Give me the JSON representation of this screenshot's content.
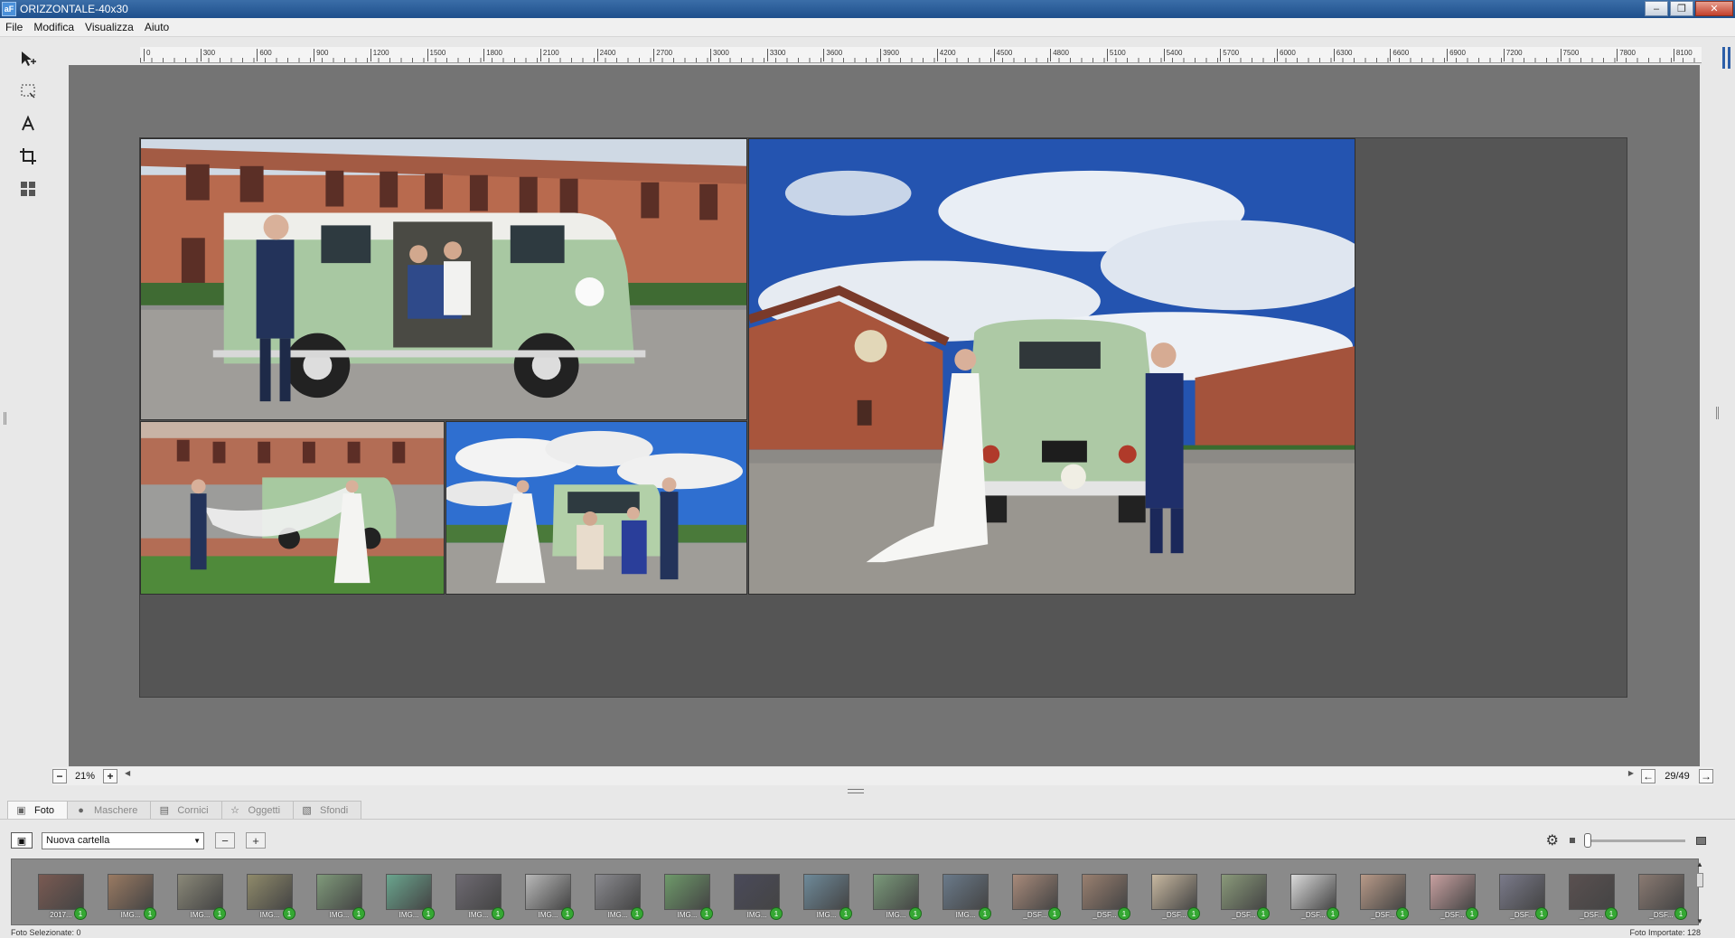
{
  "window": {
    "title": "ORIZZONTALE-40x30",
    "app_icon": "aF"
  },
  "menu": [
    "File",
    "Modifica",
    "Visualizza",
    "Aiuto"
  ],
  "tools": [
    "select-arrow",
    "marquee-select",
    "text-tool",
    "crop-tool",
    "grid-layout"
  ],
  "ruler": [
    "0",
    "300",
    "600",
    "900",
    "1200",
    "1500",
    "1800",
    "2100",
    "2400",
    "2700",
    "3000",
    "3300",
    "3600",
    "3900",
    "4200",
    "4500",
    "4800",
    "5100",
    "5400",
    "5700",
    "6000",
    "6300",
    "6600",
    "6900",
    "7200",
    "7500",
    "7800",
    "8100"
  ],
  "zoom": {
    "value": "21%",
    "minus": "−",
    "plus": "+"
  },
  "page_counter": "29/49",
  "tabs": [
    {
      "label": "Foto",
      "icon": "photo-icon",
      "active": true
    },
    {
      "label": "Maschere",
      "icon": "mask-icon",
      "active": false
    },
    {
      "label": "Cornici",
      "icon": "frame-icon",
      "active": false
    },
    {
      "label": "Oggetti",
      "icon": "star-icon",
      "active": false
    },
    {
      "label": "Sfondi",
      "icon": "background-icon",
      "active": false
    }
  ],
  "folder": {
    "selected": "Nuova cartella"
  },
  "thumbnails": [
    {
      "label": "2017...",
      "badge": "1",
      "color": "#7a5a52"
    },
    {
      "label": "IMG...",
      "badge": "1",
      "color": "#9a7a62"
    },
    {
      "label": "IMG...",
      "badge": "1",
      "color": "#8a8878"
    },
    {
      "label": "IMG...",
      "badge": "1",
      "color": "#8f8a6a"
    },
    {
      "label": "IMG...",
      "badge": "1",
      "color": "#7f9a7a"
    },
    {
      "label": "IMG...",
      "badge": "1",
      "color": "#6aa58e"
    },
    {
      "label": "IMG...",
      "badge": "1",
      "color": "#6e6a72"
    },
    {
      "label": "IMG...",
      "badge": "1",
      "color": "#b8b8b8"
    },
    {
      "label": "IMG...",
      "badge": "1",
      "color": "#8a8a8f"
    },
    {
      "label": "IMG...",
      "badge": "1",
      "color": "#6e9a6a"
    },
    {
      "label": "IMG...",
      "badge": "1",
      "color": "#4a4a5a"
    },
    {
      "label": "IMG...",
      "badge": "1",
      "color": "#6e8a9a"
    },
    {
      "label": "IMG...",
      "badge": "1",
      "color": "#7a9a7a"
    },
    {
      "label": "IMG...",
      "badge": "1",
      "color": "#6a7a8a"
    },
    {
      "label": "_DSF...",
      "badge": "1",
      "color": "#a88a7a"
    },
    {
      "label": "_DSF...",
      "badge": "1",
      "color": "#9a8070"
    },
    {
      "label": "_DSF...",
      "badge": "1",
      "color": "#c8b8a0"
    },
    {
      "label": "_DSF...",
      "badge": "1",
      "color": "#8a9a7a"
    },
    {
      "label": "_DSF...",
      "badge": "1",
      "color": "#dadada"
    },
    {
      "label": "_DSF...",
      "badge": "1",
      "color": "#b89a88"
    },
    {
      "label": "_DSF...",
      "badge": "1",
      "color": "#c8a0a0"
    },
    {
      "label": "_DSF...",
      "badge": "1",
      "color": "#7a7a8a"
    },
    {
      "label": "_DSF...",
      "badge": "1",
      "color": "#5a5050"
    },
    {
      "label": "_DSF...",
      "badge": "1",
      "color": "#8a7a72"
    }
  ],
  "status": {
    "selected": "Foto Selezionate: 0",
    "imported": "Foto Importate: 128"
  }
}
